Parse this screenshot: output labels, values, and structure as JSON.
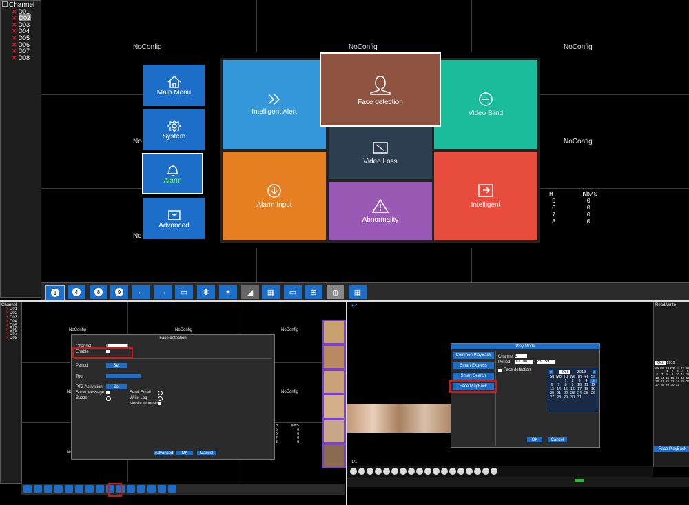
{
  "top": {
    "channel_tree": {
      "title": "Channel",
      "items": [
        "D01",
        "D02",
        "D03",
        "D04",
        "D05",
        "D06",
        "D07",
        "D08"
      ],
      "selected": "D02"
    },
    "camera_labels": [
      "NoConfig",
      "NoConfig",
      "NoConfig",
      "No",
      "NoConfig",
      "Nc",
      "Nc"
    ],
    "stats": {
      "headers": [
        "H",
        "Kb/S"
      ],
      "rows": [
        [
          "5",
          "0"
        ],
        [
          "6",
          "0"
        ],
        [
          "7",
          "0"
        ],
        [
          "8",
          "0"
        ]
      ]
    },
    "side_menu": [
      {
        "label": "Main Menu",
        "icon": "home-icon"
      },
      {
        "label": "System",
        "icon": "gear-icon"
      },
      {
        "label": "Alarm",
        "icon": "bell-icon",
        "active": true
      },
      {
        "label": "Advanced",
        "icon": "bag-icon"
      }
    ],
    "tiles": {
      "intelligent_alert": "Intelligent Alert",
      "face_detection": "Face detection",
      "video_blind": "Video Blind",
      "video_loss": "Video Loss",
      "alarm_input": "Alarm Input",
      "abnormality": "Abnormality",
      "intelligent": "Intelligent"
    },
    "toolbar": [
      "1",
      "4",
      "8",
      "9"
    ],
    "colors": {
      "blue": "#3498db",
      "brown": "#8e5441",
      "teal": "#1abc9c",
      "slate": "#2c3e50",
      "orange": "#e67e22",
      "purple": "#9b59b6",
      "red": "#e74c3c"
    }
  },
  "bottom_left": {
    "channel_tree": {
      "title": "Channel",
      "items": [
        "D01",
        "D02",
        "D03",
        "D04",
        "D05",
        "D06",
        "D07",
        "D08"
      ]
    },
    "camera_labels": [
      "NoConfig",
      "NoConfig",
      "NoConfig",
      "NoConfig",
      "No",
      "Nc"
    ],
    "dialog": {
      "title": "Face detection",
      "channel_label": "Channel",
      "channel_value": "1",
      "enable_label": "Enable",
      "period_label": "Period",
      "tour_label": "Tour",
      "ptz_label": "PTZ Activation",
      "show_message_label": "Show Message",
      "buzzer_label": "Buzzer",
      "send_email_label": "Send Email",
      "write_log_label": "Write Log",
      "mobile_reported_label": "Mobile reported",
      "set_label": "Set",
      "advanced_label": "Advanced",
      "ok_label": "OK",
      "cancel_label": "Cancel"
    },
    "stats": {
      "headers": [
        "H",
        "Kb/S"
      ],
      "rows": [
        [
          "5",
          "0"
        ],
        [
          "6",
          "0"
        ],
        [
          "7",
          "0"
        ],
        [
          "8",
          "0"
        ]
      ]
    }
  },
  "bottom_right": {
    "play_mode": {
      "title": "Play Mode",
      "modes": [
        "Common PlayBack",
        "Smart Express",
        "Smart Search",
        "Face PlayBack"
      ],
      "channel_label": "Channel",
      "channel_value": "1",
      "period_label": "Period",
      "period_from": "00 : 00",
      "period_to": "23 : 59",
      "face_detection_label": "Face detection",
      "ok_label": "OK",
      "cancel_label": "Cancel"
    },
    "calendar": {
      "month": "Oct",
      "year": "2019",
      "weekdays": [
        "Su",
        "Mo",
        "Tu",
        "We",
        "Th",
        "Fr",
        "Sa"
      ],
      "days": [
        "",
        "",
        "1",
        "2",
        "3",
        "4",
        "5",
        "6",
        "7",
        "8",
        "9",
        "10",
        "11",
        "12",
        "13",
        "14",
        "15",
        "16",
        "17",
        "18",
        "19",
        "20",
        "21",
        "22",
        "23",
        "24",
        "25",
        "26",
        "27",
        "28",
        "29",
        "30",
        "31"
      ],
      "highlight": "5"
    },
    "right_panel": {
      "mode_label": "Read/Write",
      "month": "Oct",
      "year": "2019",
      "face_playback_label": "Face PlayBack"
    },
    "counter": "1/1"
  }
}
